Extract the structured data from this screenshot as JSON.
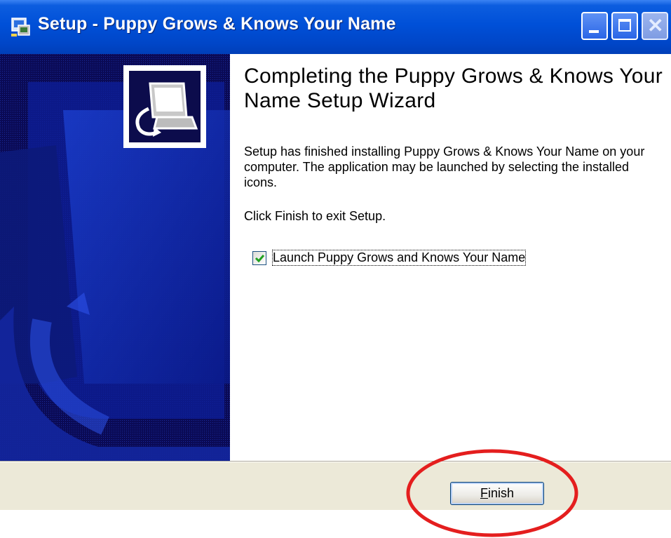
{
  "window": {
    "title": "Setup - Puppy Grows & Knows Your Name",
    "controls": {
      "minimize": "minimize",
      "maximize": "maximize",
      "close": "close"
    }
  },
  "content": {
    "heading": "Completing the Puppy Grows & Knows Your Name Setup Wizard",
    "body": "Setup has finished installing Puppy Grows & Knows Your Name on your computer. The application may be launched by selecting the installed icons.",
    "exit_hint": "Click Finish to exit Setup.",
    "launch_checkbox": {
      "label": "Launch Puppy Grows and Knows Your Name",
      "checked": true
    }
  },
  "footer": {
    "finish_button": {
      "mnemonic": "F",
      "rest": "inish"
    }
  },
  "colors": {
    "titlebar": "#0050d8",
    "sidebar": "#0a0a4a",
    "annotation": "#e41e1e",
    "checkmark": "#21a121"
  },
  "icons": [
    "setup-app-icon",
    "wizard-computer-icon",
    "checkmark-icon",
    "minimize-icon",
    "maximize-icon",
    "close-icon"
  ]
}
